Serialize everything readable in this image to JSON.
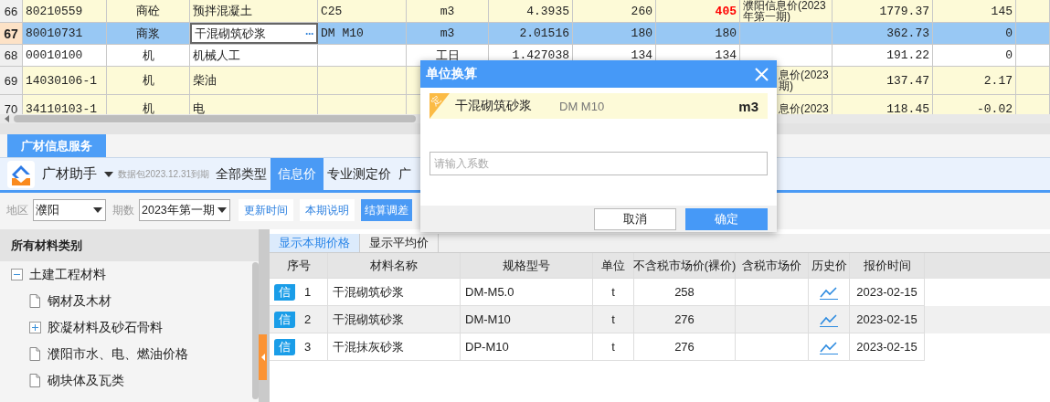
{
  "grid": {
    "edit_button": "···",
    "rows": [
      {
        "row_number": "66",
        "selected": false,
        "highlighted": true,
        "price_alert": true,
        "cells": [
          "80210559",
          "商砼",
          "预拌混凝土",
          "C25",
          "m3",
          "4.3935",
          "260",
          "405",
          "濮阳信息价(2023年第一期)",
          "1779.37",
          "145"
        ]
      },
      {
        "row_number": "67",
        "selected": true,
        "highlighted": false,
        "price_alert": false,
        "cells": [
          "80010731",
          "商浆",
          "干混砌筑砂浆",
          "DM M10",
          "m3",
          "2.01516",
          "180",
          "180",
          null,
          "362.73",
          "0"
        ]
      },
      {
        "row_number": "68",
        "selected": false,
        "highlighted": false,
        "price_alert": false,
        "cells": [
          "00010100",
          "机",
          "机械人工",
          null,
          "工日",
          "1.427038",
          "134",
          "134",
          null,
          "191.22",
          "0"
        ]
      },
      {
        "row_number": "69",
        "selected": false,
        "highlighted": true,
        "cells": [
          "14030106-1",
          "机",
          "柴油",
          null,
          null,
          null,
          null,
          null,
          "息价(2023\n期)",
          "137.47",
          "2.17"
        ]
      },
      {
        "row_number": "70",
        "selected": false,
        "highlighted": true,
        "cells": [
          "34110103-1",
          "机",
          "电",
          null,
          null,
          null,
          null,
          null,
          "息价(2023",
          "118.45",
          "-0.02"
        ]
      }
    ]
  },
  "info_panel": {
    "tab": "广材信息服务",
    "brand": "广材助手",
    "package_note": "数据包2023.12.31到期",
    "nav": [
      {
        "label": "全部类型",
        "selected": false
      },
      {
        "label": "信息价",
        "selected": true
      },
      {
        "label": "专业测定价",
        "selected": false
      },
      {
        "label": "广",
        "selected": false
      }
    ],
    "filters": {
      "region_label": "地区",
      "region": "濮阳",
      "period_label": "期数",
      "period": "2023年第一期"
    },
    "actions": [
      {
        "label": "更新时间",
        "primary": false
      },
      {
        "label": "本期说明",
        "primary": false
      },
      {
        "label": "结算调差",
        "primary": true
      }
    ],
    "categories": {
      "title": "所有材料类别",
      "tree": [
        {
          "label": "土建工程材料",
          "kind": "folder",
          "expanded": true,
          "children": [
            {
              "label": "钢材及木材",
              "kind": "leaf"
            },
            {
              "label": "胶凝材料及砂石骨料",
              "kind": "folder",
              "expanded": false
            },
            {
              "label": "濮阳市水、电、燃油价格",
              "kind": "leaf"
            },
            {
              "label": "砌块体及瓦类",
              "kind": "leaf"
            }
          ]
        }
      ]
    },
    "view_tabs": [
      {
        "label": "显示本期价格",
        "selected": true
      },
      {
        "label": "显示平均价",
        "selected": false
      }
    ],
    "table": {
      "columns": [
        "序号",
        "材料名称",
        "规格型号",
        "单位",
        "不含税市场价(裸价)",
        "含税市场价",
        "历史价",
        "报价时间"
      ],
      "rows": [
        {
          "badge": "信",
          "index": "1",
          "name": "干混砌筑砂浆",
          "spec": "DM-M5.0",
          "unit": "t",
          "price_ex_tax": "258",
          "date": "2023-02-15"
        },
        {
          "badge": "信",
          "index": "2",
          "name": "干混砌筑砂浆",
          "spec": "DM-M10",
          "unit": "t",
          "price_ex_tax": "276",
          "date": "2023-02-15"
        },
        {
          "badge": "信",
          "index": "3",
          "name": "干混抹灰砂浆",
          "spec": "DP-M10",
          "unit": "t",
          "price_ex_tax": "276",
          "date": "2023-02-15"
        }
      ]
    }
  },
  "dialog": {
    "title": "单位换算",
    "item": {
      "badge": "定",
      "name": "干混砌筑砂浆",
      "spec": "DM M10",
      "unit": "m3"
    },
    "input": {
      "placeholder": "请输入系数"
    },
    "buttons": [
      {
        "label": "取消",
        "primary": false
      },
      {
        "label": "确定",
        "primary": true
      }
    ]
  }
}
